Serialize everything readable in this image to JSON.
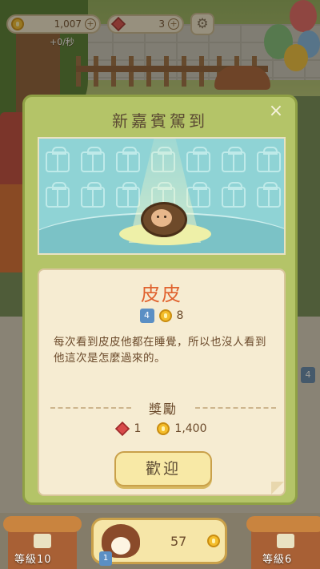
{
  "hud": {
    "coins": "1,007",
    "gems": "3",
    "rate": "+0/秒",
    "plus": "+"
  },
  "modal": {
    "title": "新嘉賓駕到",
    "close": "×",
    "guest_name": "皮皮",
    "guest_level": "4",
    "guest_coin_value": "8",
    "description": "每次看到皮皮他都在睡覺，所以也沒人看到他這次是怎麼過來的。",
    "reward_title": "獎勵",
    "reward_gems": "1",
    "reward_coins": "1,400",
    "welcome_button": "歡迎"
  },
  "side": {
    "right_badge": "4"
  },
  "bottom": {
    "left_level": "等級10",
    "right_level": "等級6",
    "cat_count": "57",
    "cat_badge": "1"
  },
  "colors": {
    "modal_green": "#b4c468",
    "name_orange": "#e0622e",
    "stage_teal": "#8fd3d5"
  }
}
